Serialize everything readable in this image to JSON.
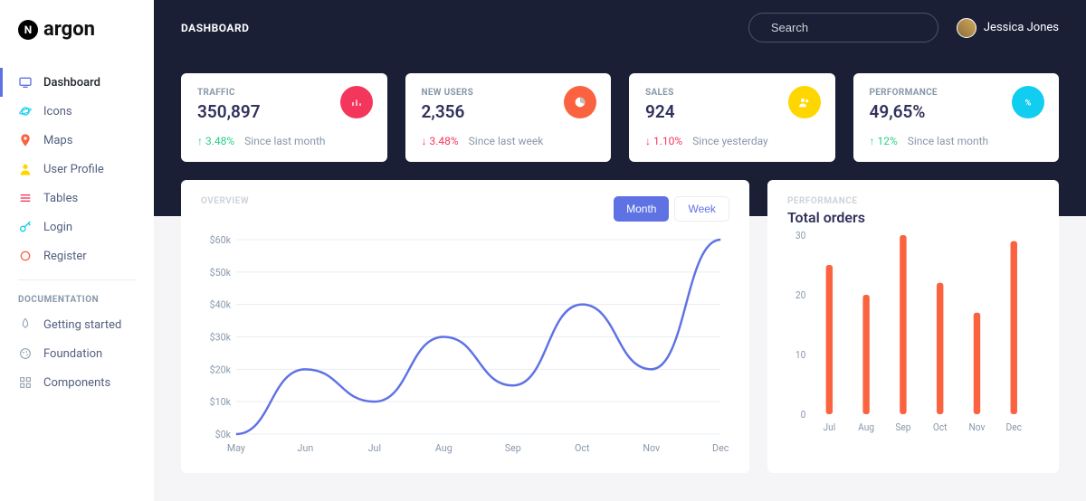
{
  "brand": "argon",
  "sidebar": {
    "items": [
      {
        "label": "Dashboard",
        "icon": "tv",
        "color": "#5e72e4",
        "active": true
      },
      {
        "label": "Icons",
        "icon": "planet",
        "color": "#11cdef"
      },
      {
        "label": "Maps",
        "icon": "pin",
        "color": "#fb6340"
      },
      {
        "label": "User Profile",
        "icon": "person",
        "color": "#ffd600"
      },
      {
        "label": "Tables",
        "icon": "list",
        "color": "#f5365c"
      },
      {
        "label": "Login",
        "icon": "key",
        "color": "#11cdef"
      },
      {
        "label": "Register",
        "icon": "circle",
        "color": "#fb6340"
      }
    ],
    "docs_heading": "DOCUMENTATION",
    "docs": [
      {
        "label": "Getting started",
        "icon": "rocket"
      },
      {
        "label": "Foundation",
        "icon": "palette"
      },
      {
        "label": "Components",
        "icon": "grid"
      }
    ]
  },
  "header": {
    "title": "DASHBOARD",
    "search_placeholder": "Search",
    "user_name": "Jessica Jones"
  },
  "stats": [
    {
      "label": "TRAFFIC",
      "value": "350,897",
      "delta": "3.48%",
      "dir": "up",
      "note": "Since last month",
      "icon_bg": "#f5365c",
      "icon": "chart"
    },
    {
      "label": "NEW USERS",
      "value": "2,356",
      "delta": "3.48%",
      "dir": "down",
      "note": "Since last week",
      "icon_bg": "#fb6340",
      "icon": "pie"
    },
    {
      "label": "SALES",
      "value": "924",
      "delta": "1.10%",
      "dir": "down",
      "note": "Since yesterday",
      "icon_bg": "#ffd600",
      "icon": "users"
    },
    {
      "label": "PERFORMANCE",
      "value": "49,65%",
      "delta": "12%",
      "dir": "up",
      "note": "Since last month",
      "icon_bg": "#11cdef",
      "icon": "percent"
    }
  ],
  "overview": {
    "overline": "OVERVIEW",
    "tabs": {
      "month": "Month",
      "week": "Week",
      "active": "month"
    }
  },
  "orders": {
    "overline": "PERFORMANCE",
    "title": "Total orders"
  },
  "chart_data": [
    {
      "type": "line",
      "title": "Overview",
      "xlabel": "",
      "ylabel": "",
      "ylim": [
        0,
        60
      ],
      "y_ticks": [
        "$0k",
        "$10k",
        "$20k",
        "$30k",
        "$40k",
        "$50k",
        "$60k"
      ],
      "categories": [
        "May",
        "Jun",
        "Jul",
        "Aug",
        "Sep",
        "Oct",
        "Nov",
        "Dec"
      ],
      "values": [
        0,
        20,
        10,
        30,
        15,
        40,
        20,
        60
      ]
    },
    {
      "type": "bar",
      "title": "Total orders",
      "xlabel": "",
      "ylabel": "",
      "ylim": [
        0,
        30
      ],
      "y_ticks": [
        0,
        10,
        20,
        30
      ],
      "categories": [
        "Jul",
        "Aug",
        "Sep",
        "Oct",
        "Nov",
        "Dec"
      ],
      "values": [
        25,
        20,
        30,
        22,
        17,
        29
      ]
    }
  ]
}
